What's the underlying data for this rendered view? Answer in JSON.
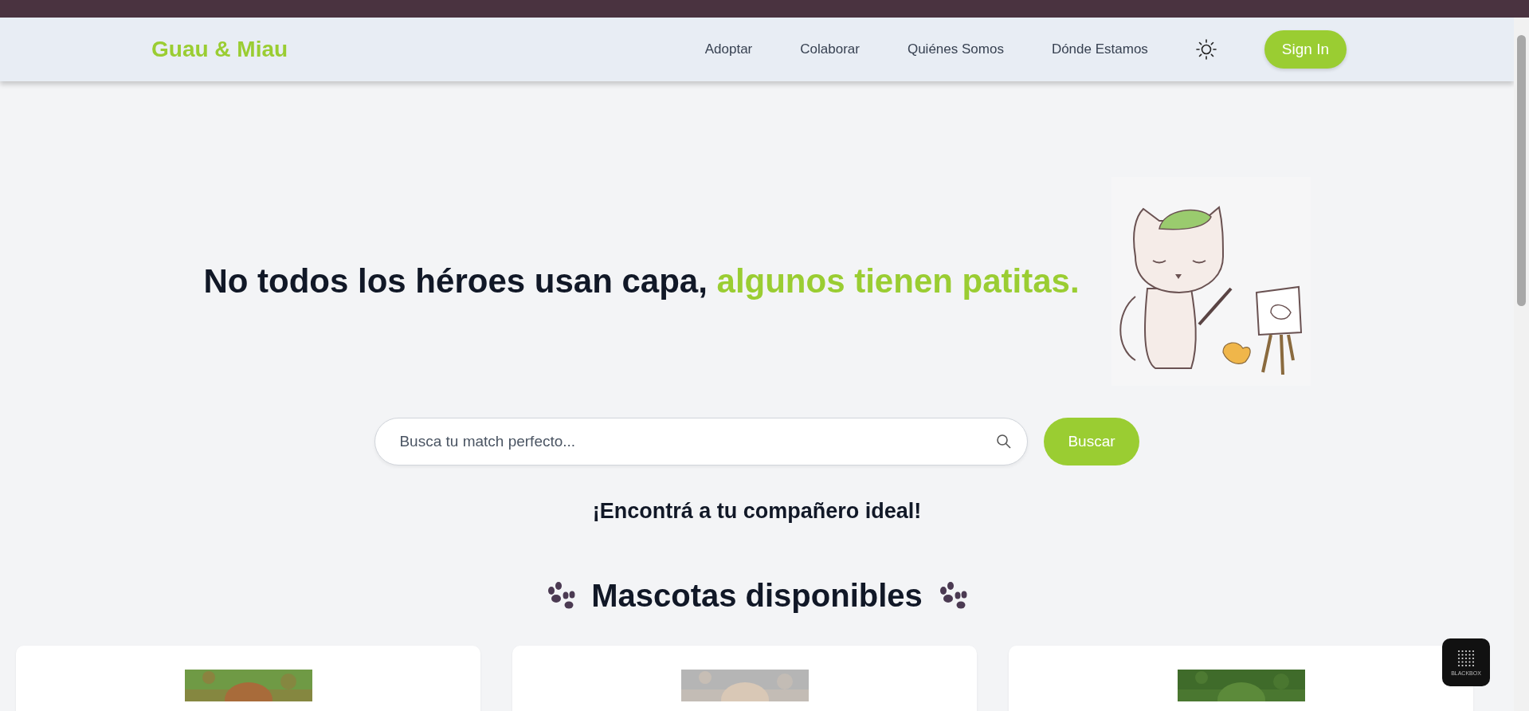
{
  "brand": "Guau & Miau",
  "nav": [
    {
      "label": "Adoptar"
    },
    {
      "label": "Colaborar"
    },
    {
      "label": "Quiénes Somos"
    },
    {
      "label": "Dónde Estamos"
    }
  ],
  "sign_in": "Sign In",
  "hero": {
    "headline": "No todos los héroes usan capa,",
    "highlight": "algunos tienen patitas."
  },
  "search": {
    "placeholder": "Busca tu match perfecto...",
    "button": "Buscar"
  },
  "tagline": "¡Encontrá a tu compañero ideal!",
  "section_title": "Mascotas disponibles",
  "badge": "BLACKBOX"
}
